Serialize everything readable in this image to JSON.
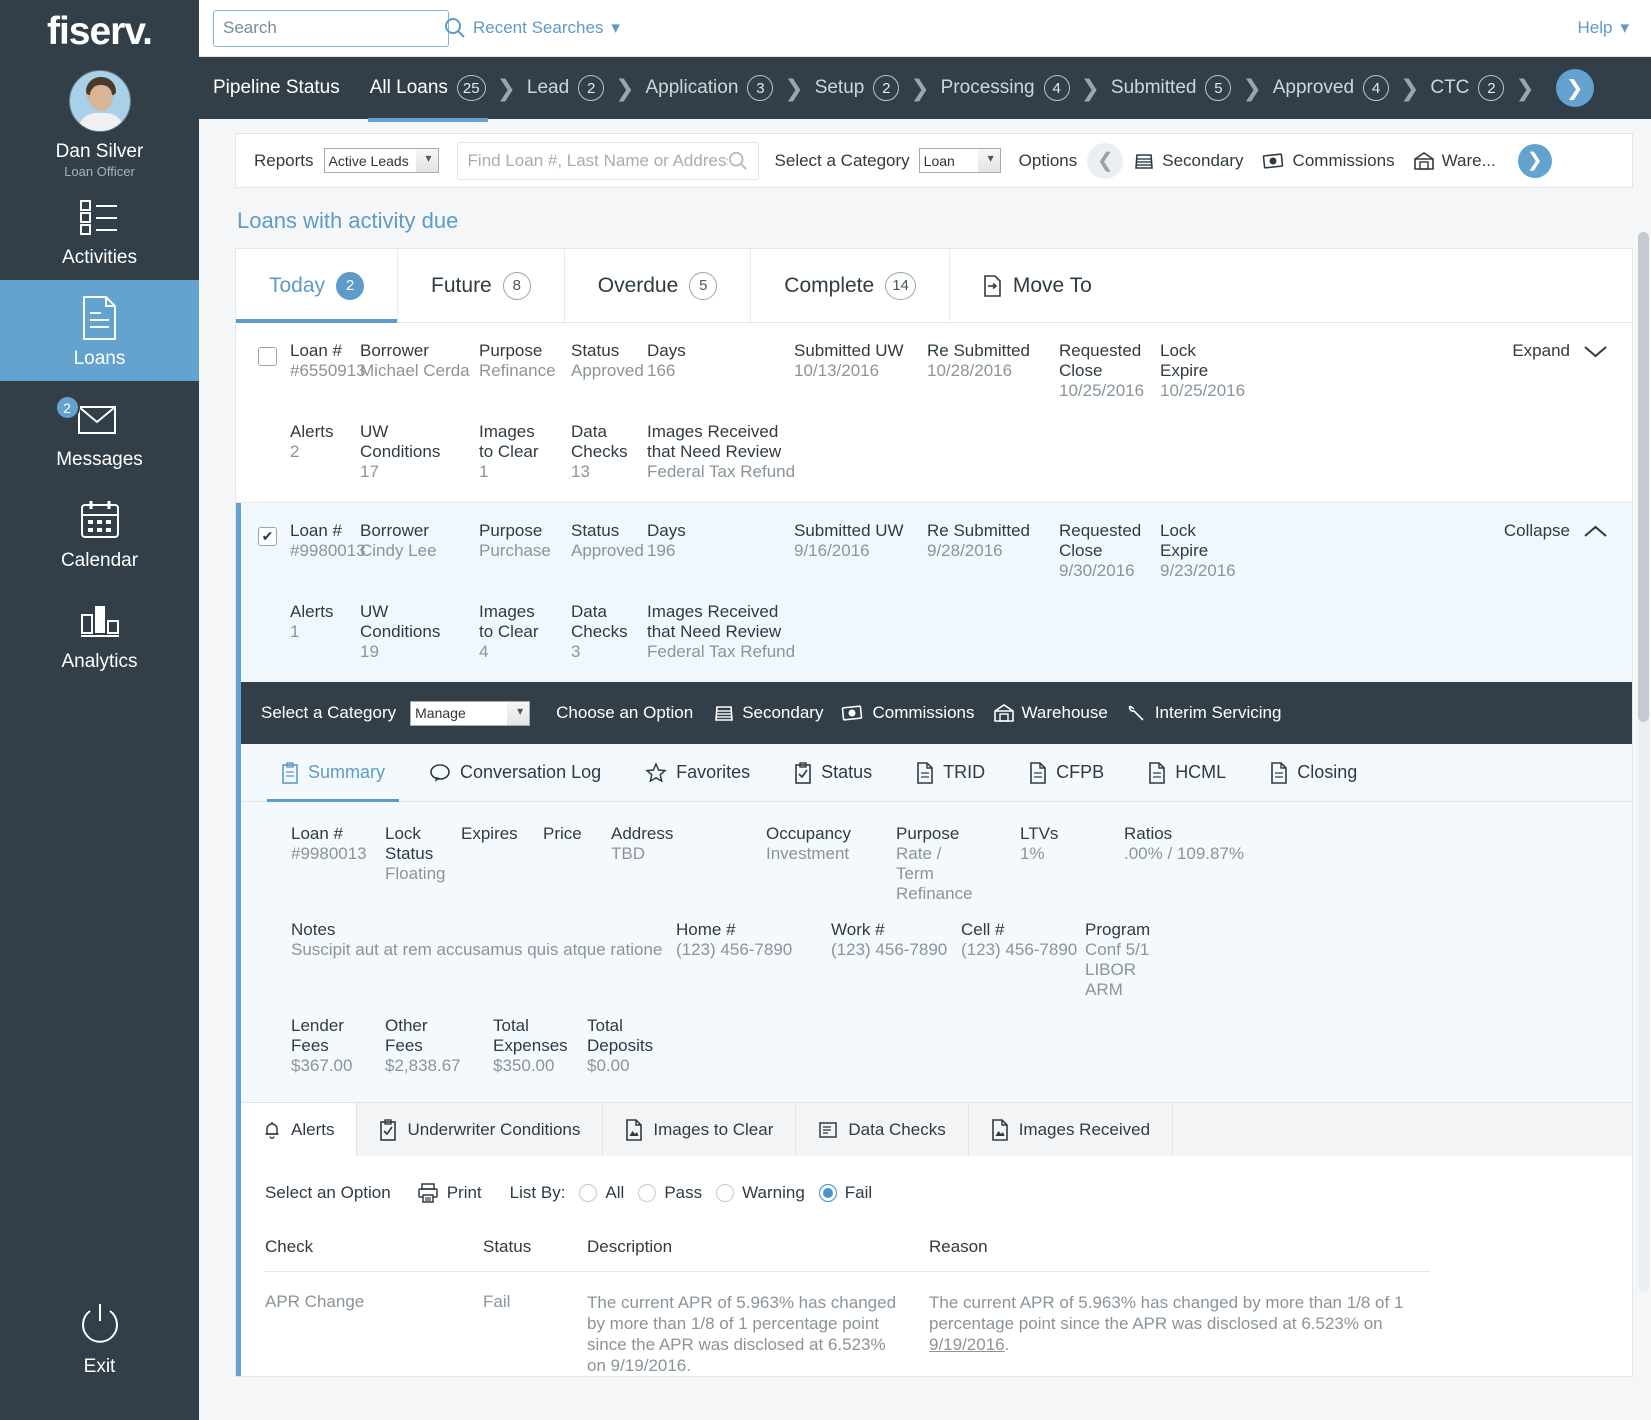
{
  "sidebar": {
    "logo": "fiserv.",
    "user": {
      "name": "Dan Silver",
      "role": "Loan Officer"
    },
    "items": [
      {
        "label": "Activities",
        "icon": "checklist-icon",
        "badge": null,
        "active": false
      },
      {
        "label": "Loans",
        "icon": "document-icon",
        "badge": null,
        "active": true
      },
      {
        "label": "Messages",
        "icon": "envelope-icon",
        "badge": "2",
        "active": false
      },
      {
        "label": "Calendar",
        "icon": "calendar-icon",
        "badge": null,
        "active": false
      },
      {
        "label": "Analytics",
        "icon": "bar-chart-icon",
        "badge": null,
        "active": false
      }
    ],
    "exit": {
      "label": "Exit",
      "icon": "power-icon"
    }
  },
  "topbar": {
    "search_placeholder": "Search",
    "search_value": "",
    "recent_searches": "Recent Searches",
    "help": "Help"
  },
  "pipeline": {
    "title": "Pipeline Status",
    "stages": [
      {
        "label": "All Loans",
        "count": "25",
        "active": true
      },
      {
        "label": "Lead",
        "count": "2",
        "active": false
      },
      {
        "label": "Application",
        "count": "3",
        "active": false
      },
      {
        "label": "Setup",
        "count": "2",
        "active": false
      },
      {
        "label": "Processing",
        "count": "4",
        "active": false
      },
      {
        "label": "Submitted",
        "count": "5",
        "active": false
      },
      {
        "label": "Approved",
        "count": "4",
        "active": false
      },
      {
        "label": "CTC",
        "count": "2",
        "active": false
      }
    ],
    "next_label": "›"
  },
  "reports_bar": {
    "reports_label": "Reports",
    "reports_value": "Active Leads",
    "find_placeholder": "Find Loan #, Last Name or Address",
    "find_value": "",
    "category_label": "Select a Category",
    "category_value": "Loan",
    "options_label": "Options",
    "tools": [
      {
        "label": "Secondary",
        "icon": "stack-icon"
      },
      {
        "label": "Commissions",
        "icon": "money-icon"
      },
      {
        "label": "Ware...",
        "icon": "warehouse-icon"
      }
    ]
  },
  "section": {
    "title": "Loans with activity due",
    "tabs": [
      {
        "label": "Today",
        "count": "2",
        "active": true
      },
      {
        "label": "Future",
        "count": "8",
        "active": false
      },
      {
        "label": "Overdue",
        "count": "5",
        "active": false
      },
      {
        "label": "Complete",
        "count": "14",
        "active": false
      }
    ],
    "move_to": "Move To"
  },
  "loans": [
    {
      "checked": false,
      "selected": false,
      "toggle_label": "Expand",
      "fields_top": [
        {
          "k": "Loan #",
          "v": "#6550913"
        },
        {
          "k": "Borrower",
          "v": "Michael Cerda"
        },
        {
          "k": "Purpose",
          "v": "Refinance"
        },
        {
          "k": "Status",
          "v": "Approved"
        },
        {
          "k": "Days",
          "v": "166"
        },
        {
          "k": "Submitted UW",
          "v": "10/13/2016"
        },
        {
          "k": "Re Submitted",
          "v": "10/28/2016"
        },
        {
          "k": "Requested Close",
          "v": "10/25/2016"
        },
        {
          "k": "Lock Expire",
          "v": "10/25/2016"
        }
      ],
      "fields_bottom": [
        {
          "k": "Alerts",
          "v": "2"
        },
        {
          "k": "UW Conditions",
          "v": "17"
        },
        {
          "k": "Images to Clear",
          "v": "1"
        },
        {
          "k": "Data Checks",
          "v": "13"
        },
        {
          "k": "Images Received that Need Review",
          "v": "Federal Tax Refund"
        }
      ]
    },
    {
      "checked": true,
      "selected": true,
      "toggle_label": "Collapse",
      "fields_top": [
        {
          "k": "Loan #",
          "v": "#9980013"
        },
        {
          "k": "Borrower",
          "v": "Cindy Lee"
        },
        {
          "k": "Purpose",
          "v": "Purchase"
        },
        {
          "k": "Status",
          "v": "Approved"
        },
        {
          "k": "Days",
          "v": "196"
        },
        {
          "k": "Submitted UW",
          "v": "9/16/2016"
        },
        {
          "k": "Re Submitted",
          "v": "9/28/2016"
        },
        {
          "k": "Requested Close",
          "v": "9/30/2016"
        },
        {
          "k": "Lock Expire",
          "v": "9/23/2016"
        }
      ],
      "fields_bottom": [
        {
          "k": "Alerts",
          "v": "1"
        },
        {
          "k": "UW Conditions",
          "v": "19"
        },
        {
          "k": "Images to Clear",
          "v": "4"
        },
        {
          "k": "Data Checks",
          "v": "3"
        },
        {
          "k": "Images Received that Need Review",
          "v": "Federal Tax Refund"
        }
      ]
    }
  ],
  "catbar": {
    "category_label": "Select a Category",
    "category_value": "Manage",
    "choose_option": "Choose an Option",
    "tools": [
      {
        "label": "Secondary",
        "icon": "stack-icon"
      },
      {
        "label": "Commissions",
        "icon": "money-icon"
      },
      {
        "label": "Warehouse",
        "icon": "warehouse-icon"
      },
      {
        "label": "Interim Servicing",
        "icon": "wrench-icon"
      }
    ]
  },
  "detail_tabs": [
    {
      "label": "Summary",
      "icon": "clipboard-icon",
      "active": true
    },
    {
      "label": "Conversation Log",
      "icon": "speech-bubble-icon",
      "active": false
    },
    {
      "label": "Favorites",
      "icon": "star-icon",
      "active": false
    },
    {
      "label": "Status",
      "icon": "checklist-clipboard-icon",
      "active": false
    },
    {
      "label": "TRID",
      "icon": "document-icon",
      "active": false
    },
    {
      "label": "CFPB",
      "icon": "document-icon",
      "active": false
    },
    {
      "label": "HCML",
      "icon": "document-icon",
      "active": false
    },
    {
      "label": "Closing",
      "icon": "document-icon",
      "active": false
    }
  ],
  "summary": {
    "row1": [
      {
        "k": "Loan #",
        "v": "#9980013"
      },
      {
        "k": "Lock Status",
        "v": "Floating"
      },
      {
        "k": "Expires",
        "v": ""
      },
      {
        "k": "Price",
        "v": ""
      },
      {
        "k": "Address",
        "v": "TBD"
      },
      {
        "k": "Occupancy",
        "v": "Investment"
      },
      {
        "k": "Purpose",
        "v": "Rate / Term Refinance"
      },
      {
        "k": "LTVs",
        "v": "1%"
      },
      {
        "k": "Ratios",
        "v": ".00% / 109.87%"
      }
    ],
    "row2": [
      {
        "k": "Notes",
        "v": "Suscipit aut at rem accusamus quis atque ratione"
      },
      {
        "k": "Home #",
        "v": "(123) 456-7890"
      },
      {
        "k": "Work #",
        "v": "(123) 456-7890"
      },
      {
        "k": "Cell #",
        "v": "(123) 456-7890"
      },
      {
        "k": "Program",
        "v": "Conf 5/1 LIBOR ARM"
      }
    ],
    "row3": [
      {
        "k": "Lender Fees",
        "v": "$367.00"
      },
      {
        "k": "Other Fees",
        "v": "$2,838.67"
      },
      {
        "k": "Total Expenses",
        "v": "$350.00"
      },
      {
        "k": "Total Deposits",
        "v": "$0.00"
      }
    ]
  },
  "bottom_tabs": [
    {
      "label": "Alerts",
      "icon": "bell-icon",
      "active": true
    },
    {
      "label": "Underwriter Conditions",
      "icon": "checklist-clipboard-icon",
      "active": false
    },
    {
      "label": "Images to Clear",
      "icon": "image-doc-icon",
      "active": false
    },
    {
      "label": "Data Checks",
      "icon": "list-check-icon",
      "active": false
    },
    {
      "label": "Images Received",
      "icon": "image-doc-icon",
      "active": false
    }
  ],
  "alerts": {
    "select_option": "Select an Option",
    "print": "Print",
    "list_by_label": "List By:",
    "radios": [
      {
        "label": "All",
        "selected": false
      },
      {
        "label": "Pass",
        "selected": false
      },
      {
        "label": "Warning",
        "selected": false
      },
      {
        "label": "Fail",
        "selected": true
      }
    ],
    "headers": [
      "Check",
      "Status",
      "Description",
      "Reason"
    ],
    "rows": [
      {
        "check": "APR Change",
        "status": "Fail",
        "description": "The current APR of 5.963% has changed by more than 1/8 of 1 percentage point since the APR was disclosed at 6.523% on 9/19/2016.",
        "reason_pre": "The current APR of 5.963% has changed by more than 1/8 of 1 percentage point since the APR was disclosed at 6.523% on ",
        "reason_link": "9/19/2016",
        "reason_post": "."
      }
    ]
  },
  "colors": {
    "accent": "#64a2cf",
    "dark": "#333f48",
    "link": "#5d9bc9"
  }
}
